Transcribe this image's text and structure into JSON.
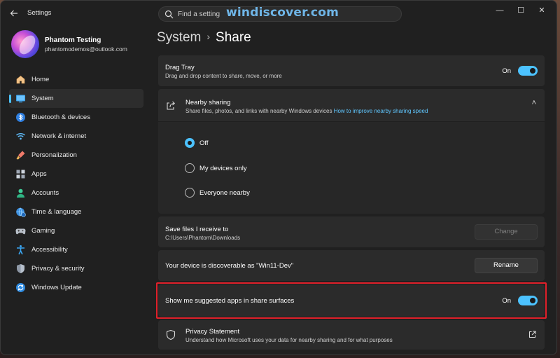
{
  "window": {
    "app_title": "Settings",
    "controls": {
      "minimize": "—",
      "maximize": "☐",
      "close": "✕"
    }
  },
  "search": {
    "placeholder": "Find a setting"
  },
  "watermark": "windiscover.com",
  "profile": {
    "name": "Phantom Testing",
    "email": "phantomodemos@outlook.com"
  },
  "nav": [
    {
      "label": "Home",
      "icon": "home-icon",
      "active": false
    },
    {
      "label": "System",
      "icon": "system-icon",
      "active": true
    },
    {
      "label": "Bluetooth & devices",
      "icon": "bluetooth-icon",
      "active": false
    },
    {
      "label": "Network & internet",
      "icon": "wifi-icon",
      "active": false
    },
    {
      "label": "Personalization",
      "icon": "brush-icon",
      "active": false
    },
    {
      "label": "Apps",
      "icon": "apps-icon",
      "active": false
    },
    {
      "label": "Accounts",
      "icon": "accounts-icon",
      "active": false
    },
    {
      "label": "Time & language",
      "icon": "globe-clock-icon",
      "active": false
    },
    {
      "label": "Gaming",
      "icon": "gamepad-icon",
      "active": false
    },
    {
      "label": "Accessibility",
      "icon": "accessibility-icon",
      "active": false
    },
    {
      "label": "Privacy & security",
      "icon": "shield-icon",
      "active": false
    },
    {
      "label": "Windows Update",
      "icon": "update-icon",
      "active": false
    }
  ],
  "breadcrumb": {
    "parent": "System",
    "separator": "›",
    "current": "Share"
  },
  "drag_tray": {
    "title": "Drag Tray",
    "subtitle": "Drag and drop content to share, move, or more",
    "state": "On"
  },
  "nearby": {
    "title": "Nearby sharing",
    "subtitle": "Share files, photos, and links with nearby Windows devices",
    "link": "How to improve nearby sharing speed",
    "chevron": "˄",
    "options": [
      {
        "label": "Off",
        "checked": true
      },
      {
        "label": "My devices only",
        "checked": false
      },
      {
        "label": "Everyone nearby",
        "checked": false
      }
    ]
  },
  "save_files": {
    "title": "Save files I receive to",
    "path": "C:\\Users\\Phantom\\Downloads",
    "button": "Change"
  },
  "discoverable": {
    "title": "Your device is discoverable as \"Win11-Dev\"",
    "button": "Rename"
  },
  "suggested_apps": {
    "title": "Show me suggested apps in share surfaces",
    "state": "On"
  },
  "privacy_statement": {
    "title": "Privacy Statement",
    "subtitle": "Understand how Microsoft uses your data for nearby sharing and for what purposes"
  },
  "colors": {
    "accent": "#4cc2ff",
    "highlight": "#e0202a",
    "link": "#60c7ff"
  }
}
